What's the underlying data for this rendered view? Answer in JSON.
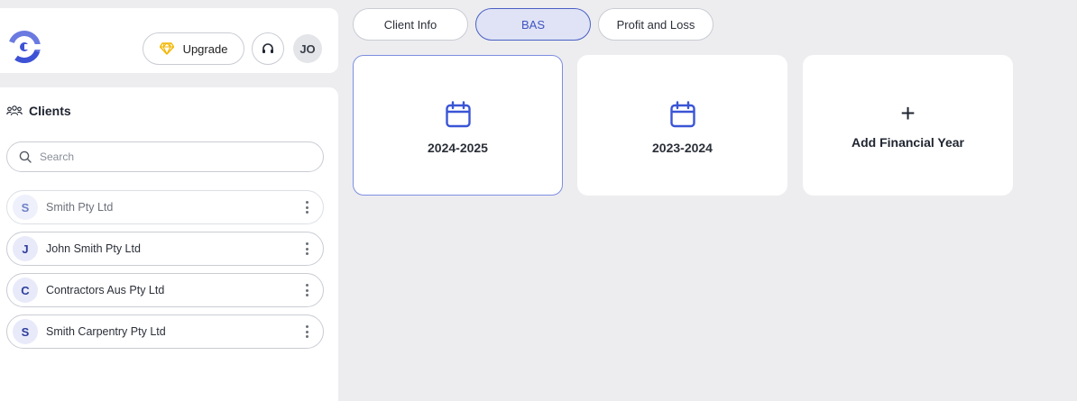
{
  "header": {
    "logo_icon": "brand-logo-icon",
    "upgrade_label": "Upgrade",
    "upgrade_icon": "diamond-icon",
    "support_icon": "headset-icon",
    "avatar_initials": "JO"
  },
  "clients": {
    "title": "Clients",
    "title_icon": "users-icon",
    "search_placeholder": "Search",
    "search_value": "",
    "items": [
      {
        "initial": "S",
        "name": "Smith Pty Ltd"
      },
      {
        "initial": "J",
        "name": "John Smith Pty Ltd"
      },
      {
        "initial": "C",
        "name": "Contractors Aus Pty Ltd"
      },
      {
        "initial": "S",
        "name": "Smith Carpentry Pty Ltd"
      }
    ]
  },
  "tabs": [
    {
      "label": "Client Info",
      "active": false
    },
    {
      "label": "BAS",
      "active": true
    },
    {
      "label": "Profit and Loss",
      "active": false
    }
  ],
  "years": [
    {
      "label": "2024-2025",
      "selected": true,
      "icon": "calendar-icon"
    },
    {
      "label": "2023-2024",
      "selected": false,
      "icon": "calendar-icon"
    }
  ],
  "add_year": {
    "label": "Add Financial Year",
    "icon_glyph": "+"
  },
  "colors": {
    "accent": "#3f54bf",
    "accent_light": "#dfe3f5",
    "calendar": "#3a55d6",
    "diamond": "#f2b600",
    "background": "#ededf0"
  }
}
